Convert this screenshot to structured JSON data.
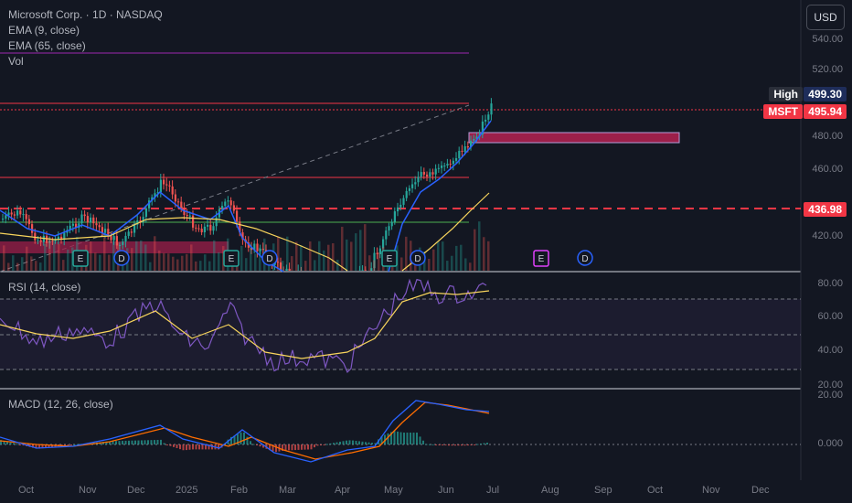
{
  "legend": {
    "symbol": "Microsoft Corp. · 1D · NASDAQ",
    "ema9": "EMA (9, close)",
    "ema65": "EMA (65, close)",
    "vol": "Vol",
    "rsi": "RSI (14, close)",
    "macd": "MACD (12, 26, close)"
  },
  "currency_button": "USD",
  "price_axis": {
    "ticks": [
      "540.00",
      "520.00",
      "480.00",
      "460.00",
      "420.00"
    ],
    "high_label": "High",
    "high_value": "499.30",
    "symbol_label": "MSFT",
    "last_value": "495.94",
    "level_value": "436.98"
  },
  "rsi_axis": {
    "ticks": [
      "80.00",
      "60.00",
      "40.00",
      "20.00"
    ]
  },
  "macd_axis": {
    "ticks": [
      "20.00",
      "0.000"
    ]
  },
  "time_axis": [
    "Oct",
    "Nov",
    "Dec",
    "2025",
    "Feb",
    "Mar",
    "Apr",
    "May",
    "Jun",
    "Jul",
    "Aug",
    "Sep",
    "Oct",
    "Nov",
    "Dec"
  ],
  "events": {
    "earnings_letter": "E",
    "dividend_letter": "D"
  },
  "colors": {
    "background": "#131722",
    "up": "#26a69a",
    "down": "#ef5350",
    "ema9": "#2962ff",
    "ema65": "#f7d45c",
    "rsi_line": "#7e57c2",
    "rsi_ma": "#f7d45c",
    "macd_line": "#2962ff",
    "signal_line": "#ff6d00",
    "resistance": "#f23645",
    "support": "#4caf50",
    "zone": "#9c1f4a",
    "purple_line": "#9c27b0"
  }
}
